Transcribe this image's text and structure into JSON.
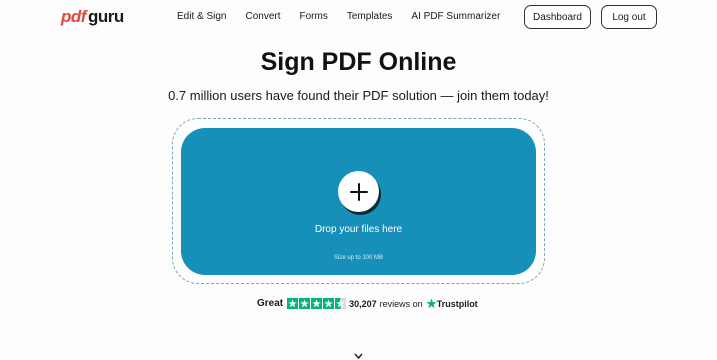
{
  "header": {
    "logo_pdf": "pdf",
    "logo_guru": "guru",
    "nav": [
      "Edit & Sign",
      "Convert",
      "Forms",
      "Templates",
      "AI PDF Summarizer"
    ],
    "dashboard_label": "Dashboard",
    "logout_label": "Log out"
  },
  "hero": {
    "title": "Sign PDF Online",
    "subtitle": "0.7 million users have found their PDF solution — join them today!"
  },
  "dropzone": {
    "drop_label": "Drop your files here",
    "size_label": "Size up to 100 MB",
    "icon": "plus-icon"
  },
  "trust": {
    "rating_word": "Great",
    "stars": 4.5,
    "review_count": "30,207",
    "reviews_on": "reviews on",
    "brand": "Trustpilot"
  },
  "colors": {
    "accent": "#1690b9",
    "logo_red": "#e2483d",
    "trust_green": "#00b67a"
  }
}
